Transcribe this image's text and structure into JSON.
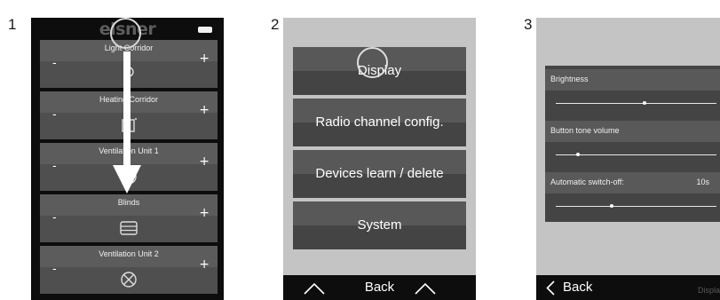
{
  "steps": [
    "1",
    "2",
    "3"
  ],
  "screen1": {
    "logo": "elsner",
    "tiles": [
      {
        "title": "Light Corridor",
        "minus": "-",
        "plus": "+",
        "icon": "bulb-icon"
      },
      {
        "title": "Heating Corridor",
        "minus": "-",
        "plus": "+",
        "icon": "radiator-icon"
      },
      {
        "title": "Ventilation Unit 1",
        "minus": "-",
        "plus": "+",
        "icon": "fan-icon"
      },
      {
        "title": "Blinds",
        "minus": "-",
        "plus": "+",
        "icon": "blinds-icon"
      },
      {
        "title": "Ventilation Unit 2",
        "minus": "-",
        "plus": "+",
        "icon": "fan-icon"
      }
    ],
    "gesture": "swipe-down-arrow"
  },
  "screen2": {
    "menu": [
      "Display",
      "Radio channel config.",
      "Devices learn / delete",
      "System"
    ],
    "back_label": "Back"
  },
  "screen3": {
    "settings": [
      {
        "label": "Brightness",
        "value": "",
        "level": 0.55
      },
      {
        "label": "Button tone volume",
        "value": "",
        "level": 0.14
      },
      {
        "label": "Automatic switch-off:",
        "value": "10s",
        "level": 0.35
      }
    ],
    "back_label": "Back",
    "breadcrumb": "Displa"
  },
  "colors": {
    "dark": "#0d0d0d",
    "panel": "#444444",
    "screen_bg": "#c4c4c4"
  }
}
